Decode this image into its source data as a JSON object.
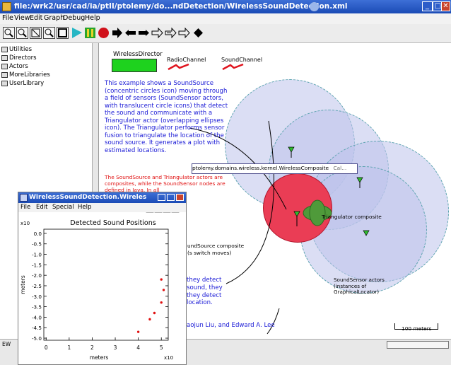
{
  "window": {
    "title": "file:/wrk2/usr/cad/ia/ptII/ptolemy/do...ndDetection/WirelessSoundDetection.xml",
    "controls": {
      "minimize": "_",
      "maximize": "□",
      "close": "✕"
    }
  },
  "menu": [
    "File",
    "View",
    "Edit",
    "Graph",
    "Debug",
    "Help"
  ],
  "toolbar_icons": [
    "zoom-in-icon",
    "zoom-reset-icon",
    "zoom-fit-icon",
    "zoom-out-icon",
    "fullscreen-icon",
    "run-icon",
    "pause-icon",
    "stop-icon",
    "step-icon",
    "step-back-icon",
    "step-forward-icon",
    "port-icon",
    "multiport-icon",
    "relation-icon",
    "vertex-icon"
  ],
  "library": [
    "Utilities",
    "Directors",
    "Actors",
    "MoreLibraries",
    "UserLibrary"
  ],
  "canvas": {
    "director_label": "WirelessDirector",
    "channel1_label": "RadioChannel",
    "channel2_label": "SoundChannel",
    "description": "This example shows a SoundSource (concentric circles icon) moving through a field of sensors (SoundSensor actors, with translucent circle icons) that detect the sound and communicate with a Triangulator actor (overlapping ellipses icon). The Triangulator performs sensor fusion to triangulate the location of the sound source. It generates a plot with estimated locations.",
    "composite_note": "The SoundSource and Triangulator actors are composites, while the SoundSensor nodes are defined in Java. In all",
    "composite_tooltip": "ptolemy.domains.wireless.kernel.WirelessComposite",
    "tooltip_extra": "Cal...",
    "triangulator_label": "Triangulator composite",
    "soundsource_label": "undSource composite",
    "soundsource_sub": "(s switch moves)",
    "sensor_label": "SoundSensor actors (instances of GraphicalLocator)",
    "blue_fragment": [
      " they detect",
      " sound, they",
      " they detect",
      " location."
    ],
    "authors": "aojun Liu, and Edward A. Lee",
    "scale_label": "100 meters"
  },
  "statusbar": {
    "left": "EW"
  },
  "plot_window": {
    "title": "WirelessSoundDetection.Wireles",
    "menu": [
      "File",
      "Edit",
      "Special",
      "Help"
    ],
    "chart_title": "Detected Sound Positions",
    "x_exponent": "x10",
    "y_exponent": "x10",
    "xlabel": "meters",
    "ylabel": "meters"
  },
  "chart_data": {
    "type": "scatter",
    "title": "Detected Sound Positions",
    "xlabel": "meters",
    "ylabel": "meters",
    "x_ticks": [
      "0",
      "1",
      "2",
      "3",
      "4",
      "5"
    ],
    "y_ticks": [
      "0.0",
      "-0.5",
      "-1.0",
      "-1.5",
      "-2.0",
      "-2.5",
      "-3.0",
      "-3.5",
      "-4.0",
      "-4.5",
      "-5.0"
    ],
    "xlim": [
      -0.1,
      5.3
    ],
    "ylim": [
      -5.1,
      0.2
    ],
    "series": [
      {
        "color": "#e01010",
        "points": [
          [
            5.0,
            -2.2
          ],
          [
            5.1,
            -2.7
          ],
          [
            5.0,
            -3.3
          ],
          [
            4.7,
            -3.8
          ],
          [
            4.5,
            -4.1
          ],
          [
            4.0,
            -4.7
          ]
        ]
      }
    ],
    "grid": false
  }
}
